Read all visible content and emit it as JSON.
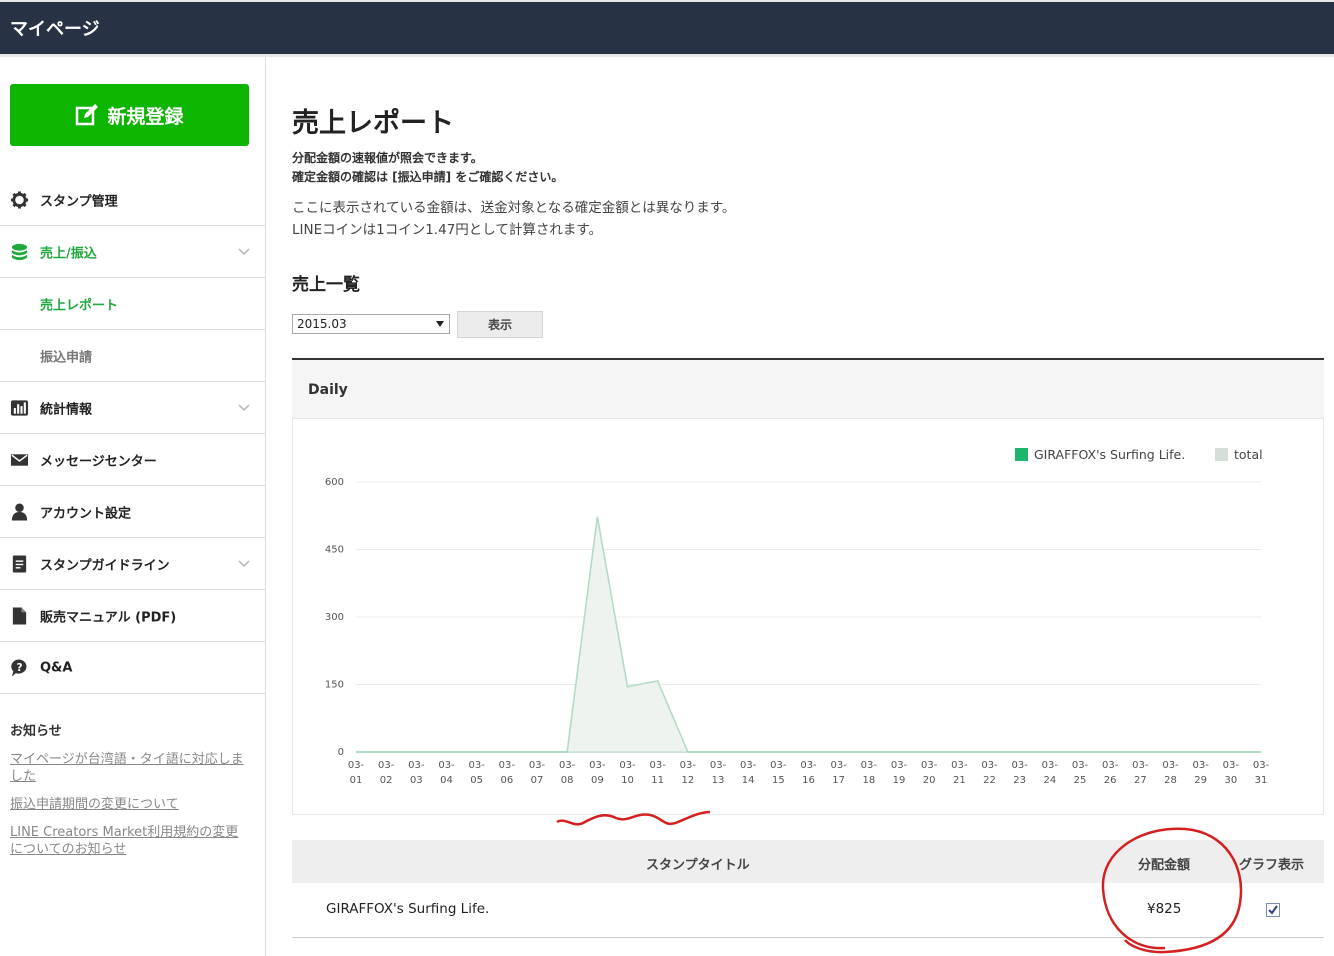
{
  "header": {
    "title": "マイページ"
  },
  "sidebar": {
    "new_button": "新規登録",
    "items": [
      {
        "label": "スタンプ管理",
        "icon": "gear-icon"
      },
      {
        "label": "売上/振込",
        "icon": "coins-icon"
      },
      {
        "label": "売上レポート"
      },
      {
        "label": "振込申請"
      },
      {
        "label": "統計情報",
        "icon": "bar-chart-icon"
      },
      {
        "label": "メッセージセンター",
        "icon": "envelope-icon"
      },
      {
        "label": "アカウント設定",
        "icon": "user-icon"
      },
      {
        "label": "スタンプガイドライン",
        "icon": "document-icon"
      },
      {
        "label": "販売マニュアル (PDF)",
        "icon": "file-icon"
      },
      {
        "label": "Q&A",
        "icon": "question-icon"
      }
    ],
    "notice": {
      "heading": "お知らせ",
      "links": [
        "マイページが台湾語・タイ語に対応しました",
        "振込申請期間の変更について",
        "LINE Creators Market利用規約の変更についてのお知らせ"
      ]
    }
  },
  "main": {
    "title": "売上レポート",
    "desc_bold_1": "分配金額の速報値が照会できます。",
    "desc_bold_2": "確定金額の確認は [振込申請] をご確認ください。",
    "desc_1": "ここに表示されている金額は、送金対象となる確定金額とは異なります。",
    "desc_2": "LINEコインは1コイン1.47円として計算されます。",
    "section_title": "売上一覧",
    "month_value": "2015.03",
    "show_button": "表示",
    "chart_heading": "Daily"
  },
  "colors": {
    "accent": "#0db400",
    "header_bg": "#283245",
    "series1": "#1db46b",
    "series2": "#d6ded8"
  },
  "chart_data": {
    "type": "area",
    "x": [
      "03-01",
      "03-02",
      "03-03",
      "03-04",
      "03-05",
      "03-06",
      "03-07",
      "03-08",
      "03-09",
      "03-10",
      "03-11",
      "03-12",
      "03-13",
      "03-14",
      "03-15",
      "03-16",
      "03-17",
      "03-18",
      "03-19",
      "03-20",
      "03-21",
      "03-22",
      "03-23",
      "03-24",
      "03-25",
      "03-26",
      "03-27",
      "03-28",
      "03-29",
      "03-30",
      "03-31"
    ],
    "series": [
      {
        "name": "GIRAFFOX's Surfing Life.",
        "values": [
          0,
          0,
          0,
          0,
          0,
          0,
          0,
          0,
          0,
          0,
          0,
          0,
          0,
          0,
          0,
          0,
          0,
          0,
          0,
          0,
          0,
          0,
          0,
          0,
          0,
          0,
          0,
          0,
          0,
          0,
          0
        ]
      },
      {
        "name": "total",
        "values": [
          0,
          0,
          0,
          0,
          0,
          0,
          0,
          0,
          523,
          145,
          158,
          0,
          0,
          0,
          0,
          0,
          0,
          0,
          0,
          0,
          0,
          0,
          0,
          0,
          0,
          0,
          0,
          0,
          0,
          0,
          0
        ]
      }
    ],
    "yticks": [
      0,
      150,
      300,
      450,
      600
    ],
    "ylim": [
      0,
      600
    ],
    "grid": true,
    "legend": "top-right"
  },
  "table": {
    "headers": [
      "スタンプタイトル",
      "分配金額",
      "グラフ表示"
    ],
    "rows": [
      {
        "title": "GIRAFFOX's Surfing Life.",
        "amount": "¥825",
        "checked": true
      }
    ]
  }
}
